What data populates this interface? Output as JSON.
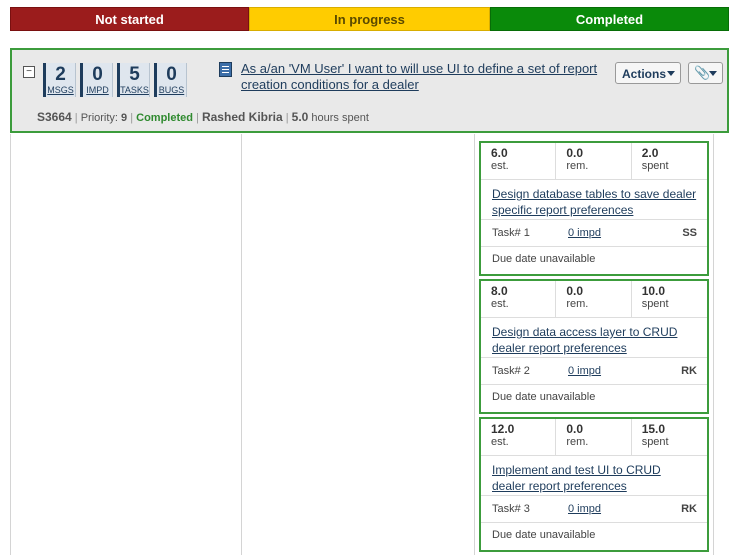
{
  "status_bar": {
    "not_started": "Not started",
    "in_progress": "In progress",
    "completed": "Completed"
  },
  "story": {
    "collapse_glyph": "−",
    "counters": [
      {
        "value": "2",
        "label": "MSGS"
      },
      {
        "value": "0",
        "label": "IMPD"
      },
      {
        "value": "5",
        "label": "TASKS"
      },
      {
        "value": "0",
        "label": "BUGS"
      }
    ],
    "title": "As a/an 'VM User' I want to will use UI to define a set of report creation conditions for a dealer",
    "actions_label": "Actions",
    "id": "S3664",
    "priority_label": "Priority:",
    "priority": "9",
    "status": "Completed",
    "owner": "Rashed Kibria",
    "hours": "5.0",
    "hours_label": "hours spent"
  },
  "tasks": [
    {
      "est": "6.0",
      "rem": "0.0",
      "spent": "2.0",
      "est_label": "est.",
      "rem_label": "rem.",
      "spent_label": "spent",
      "title": "Design database tables to save dealer specific report preferences",
      "task_no": "Task# 1",
      "impd": "0 impd",
      "initials": "SS",
      "due": "Due date unavailable"
    },
    {
      "est": "8.0",
      "rem": "0.0",
      "spent": "10.0",
      "est_label": "est.",
      "rem_label": "rem.",
      "spent_label": "spent",
      "title": "Design data access layer to CRUD dealer report preferences",
      "task_no": "Task# 2",
      "impd": "0 impd",
      "initials": "RK",
      "due": "Due date unavailable"
    },
    {
      "est": "12.0",
      "rem": "0.0",
      "spent": "15.0",
      "est_label": "est.",
      "rem_label": "rem.",
      "spent_label": "spent",
      "title": "Implement and test UI to CRUD dealer report preferences",
      "task_no": "Task# 3",
      "impd": "0 impd",
      "initials": "RK",
      "due": "Due date unavailable"
    }
  ],
  "colors": {
    "not_started": "#9b1c1c",
    "in_progress": "#ffcc00",
    "completed": "#0a8a0a",
    "card_border": "#3c9c3c",
    "link": "#1e3c5c"
  }
}
